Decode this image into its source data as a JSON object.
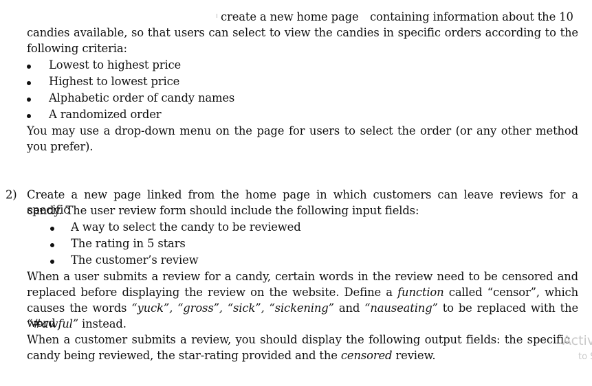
{
  "section1": {
    "intro_line1_left": "create a new home page",
    "intro_line1_right": "containing information about the 10",
    "intro_line2": "candies available, so that users can select to view the candies in specific orders according to the",
    "intro_line3": "following criteria:",
    "criteria": [
      "Lowest to highest price",
      "Highest to lowest price",
      "Alphabetic order of candy names",
      "A randomized order"
    ],
    "note_line1": "You may use a drop-down menu on the page for users to select the order (or any other method",
    "note_line2": "you prefer)."
  },
  "section2": {
    "number": "2)",
    "intro_line1": "Create a new page linked from the home page in which customers can leave reviews for a specific",
    "intro_line2": "candy. The user review form should include the following input fields:",
    "fields": [
      "A way to select the candy to be reviewed",
      "The rating in 5 stars",
      "The customer’s review"
    ],
    "censor_line1": "When a user submits a review for a candy, certain words in the review need to be censored and",
    "censor_line2_a": "replaced before displaying the review on the website. Define a ",
    "censor_line2_em": "function",
    "censor_line2_b": " called “censor”, which",
    "censor_line3_a": "causes the words ",
    "censor_words": "“yuck”, “gross”, “sick”, “sickening”",
    "censor_line3_and": " and ",
    "censor_word_last": "“nauseating”",
    "censor_line3_b": " to be replaced with the word",
    "replacement_word": "“#awful”",
    "censor_line4_b": " instead.",
    "output_line1": "When a customer submits a review, you should display the following output fields: the specific",
    "output_line2_a": "candy being reviewed, the star-rating provided and the ",
    "output_line2_em": "censored",
    "output_line2_b": " review."
  },
  "watermark": {
    "line1": "Activ",
    "line2": "to S"
  }
}
